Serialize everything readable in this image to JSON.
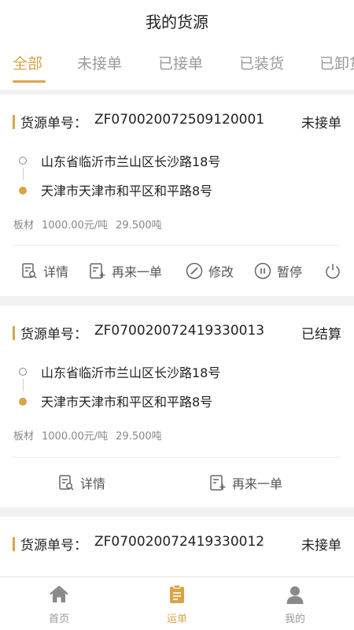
{
  "header": {
    "title": "我的货源"
  },
  "tabs": [
    {
      "label": "全部",
      "active": true
    },
    {
      "label": "未接单",
      "active": false
    },
    {
      "label": "已接单",
      "active": false
    },
    {
      "label": "已装货",
      "active": false
    },
    {
      "label": "已卸货",
      "active": false
    }
  ],
  "orders": [
    {
      "order_label": "货源单号：",
      "order_no": "ZF07002007250912000​1",
      "status": "未接单",
      "from": "山东省临沂市兰山区长沙路18号",
      "to": "天津市天津市和平区和平路8号",
      "cargo": "板材",
      "price": "1000.00元/吨",
      "weight": "29.500吨",
      "actions": [
        "详情",
        "再来一单",
        "修改",
        "暂停"
      ]
    },
    {
      "order_label": "货源单号：",
      "order_no": "ZF07002007241933001​3",
      "status": "已结算",
      "from": "山东省临沂市兰山区长沙路18号",
      "to": "天津市天津市和平区和平路8号",
      "cargo": "板材",
      "price": "1000.00元/吨",
      "weight": "29.500吨",
      "actions": [
        "详情",
        "再来一单"
      ]
    },
    {
      "order_label": "货源单号：",
      "order_no": "ZF07002007241933001​2",
      "status": "未接单"
    }
  ],
  "bottom_nav": [
    {
      "label": "首页",
      "icon": "home-icon",
      "active": false
    },
    {
      "label": "运单",
      "icon": "waybill-icon",
      "active": true
    },
    {
      "label": "我的",
      "icon": "profile-icon",
      "active": false
    }
  ],
  "colors": {
    "accent": "#d8a44a",
    "text": "#222222",
    "muted": "#888888",
    "background": "#f2f2f2"
  }
}
